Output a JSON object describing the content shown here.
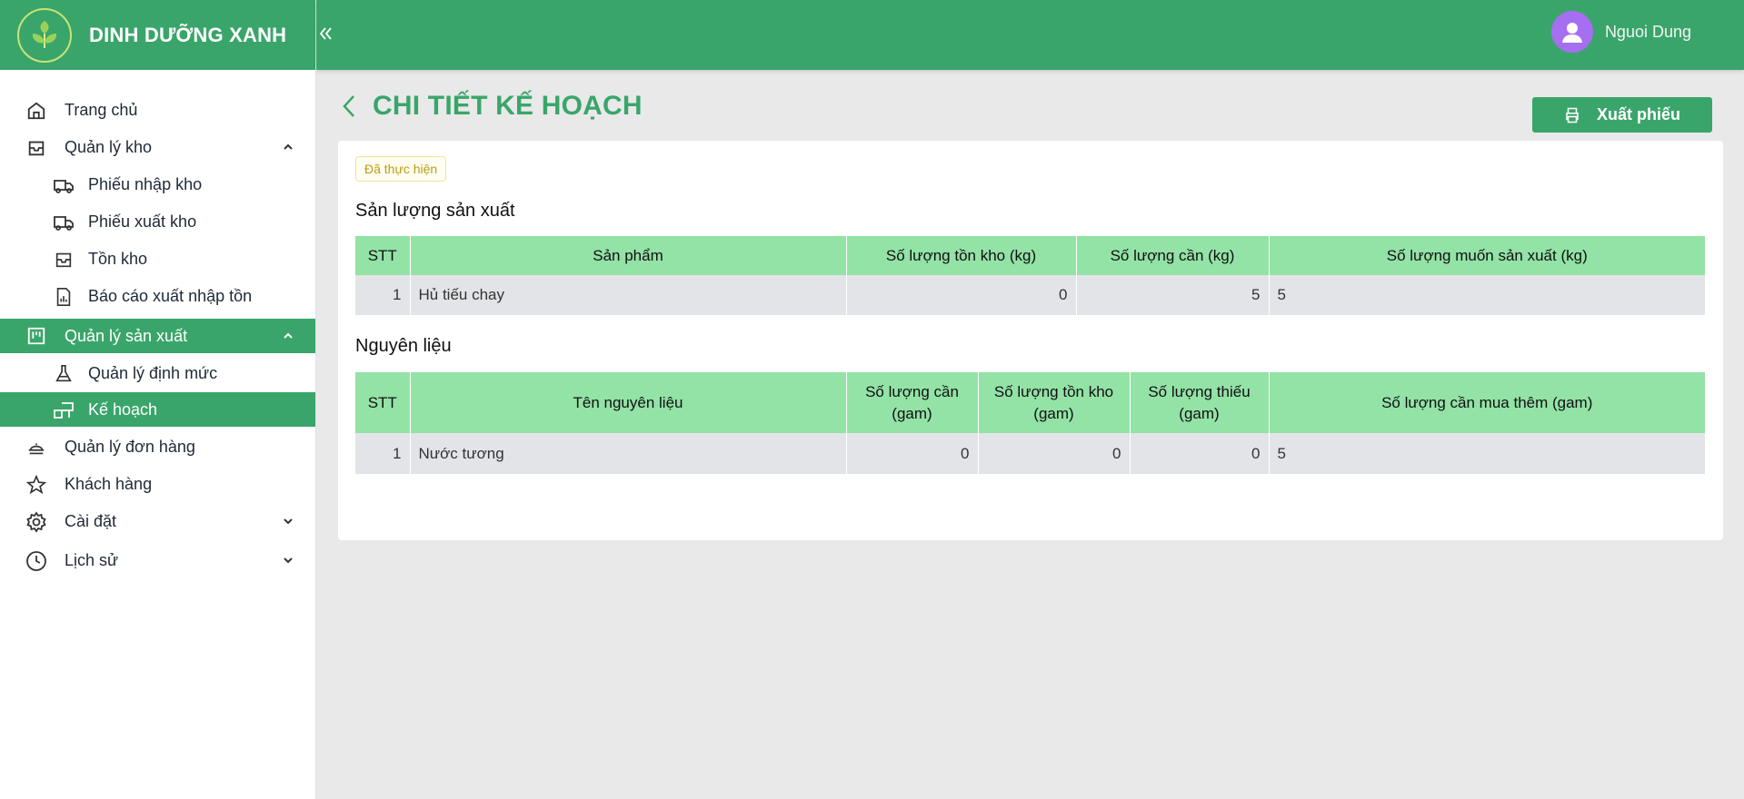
{
  "brand": {
    "name": "DINH DƯỠNG XANH"
  },
  "user": {
    "name": "Nguoi Dung"
  },
  "sidebar": {
    "items": [
      {
        "label": "Trang chủ"
      },
      {
        "label": "Quản lý kho"
      },
      {
        "label": "Phiếu nhập kho"
      },
      {
        "label": "Phiếu xuất kho"
      },
      {
        "label": "Tồn kho"
      },
      {
        "label": "Báo cáo xuất nhập tồn"
      },
      {
        "label": "Quản lý sản xuất"
      },
      {
        "label": "Quản lý định mức"
      },
      {
        "label": "Kế hoạch"
      },
      {
        "label": "Quản lý đơn hàng"
      },
      {
        "label": "Khách hàng"
      },
      {
        "label": "Cài đặt"
      },
      {
        "label": "Lịch sử"
      }
    ]
  },
  "page": {
    "title": "CHI TIẾT KẾ HOẠCH",
    "export_label": "Xuất phiếu",
    "status": "Đã thực hiện"
  },
  "production": {
    "title": "Sản lượng sản xuất",
    "headers": [
      "STT",
      "Sản phẩm",
      "Số lượng tồn kho (kg)",
      "Số lượng cần (kg)",
      "Số lượng muốn sản xuất (kg)"
    ],
    "rows": [
      [
        "1",
        "Hủ tiếu chay",
        "0",
        "5",
        "5"
      ]
    ]
  },
  "materials": {
    "title": "Nguyên liệu",
    "headers": [
      "STT",
      "Tên nguyên liệu",
      "Số lượng cần (gam)",
      "Số lượng tồn kho (gam)",
      "Số lượng thiếu (gam)",
      "Số lượng cần mua thêm (gam)"
    ],
    "rows": [
      [
        "1",
        "Nước tương",
        "0",
        "0",
        "0",
        "5"
      ]
    ]
  },
  "colors": {
    "primary": "#3aa56a",
    "table_header": "#93e2a6",
    "avatar": "#a66ef0"
  }
}
